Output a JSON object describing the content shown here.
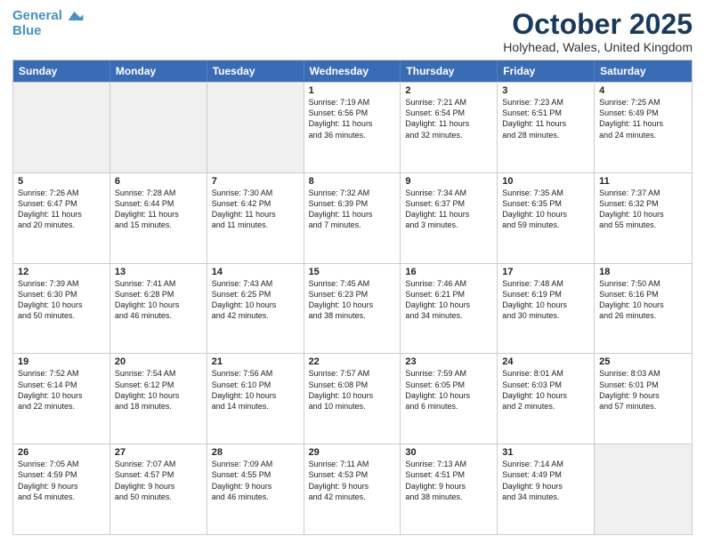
{
  "header": {
    "logo_line1": "General",
    "logo_line2": "Blue",
    "month": "October 2025",
    "location": "Holyhead, Wales, United Kingdom"
  },
  "days_of_week": [
    "Sunday",
    "Monday",
    "Tuesday",
    "Wednesday",
    "Thursday",
    "Friday",
    "Saturday"
  ],
  "rows": [
    [
      {
        "day": "",
        "text": "",
        "shaded": true
      },
      {
        "day": "",
        "text": "",
        "shaded": true
      },
      {
        "day": "",
        "text": "",
        "shaded": true
      },
      {
        "day": "1",
        "text": "Sunrise: 7:19 AM\nSunset: 6:56 PM\nDaylight: 11 hours\nand 36 minutes."
      },
      {
        "day": "2",
        "text": "Sunrise: 7:21 AM\nSunset: 6:54 PM\nDaylight: 11 hours\nand 32 minutes."
      },
      {
        "day": "3",
        "text": "Sunrise: 7:23 AM\nSunset: 6:51 PM\nDaylight: 11 hours\nand 28 minutes."
      },
      {
        "day": "4",
        "text": "Sunrise: 7:25 AM\nSunset: 6:49 PM\nDaylight: 11 hours\nand 24 minutes."
      }
    ],
    [
      {
        "day": "5",
        "text": "Sunrise: 7:26 AM\nSunset: 6:47 PM\nDaylight: 11 hours\nand 20 minutes."
      },
      {
        "day": "6",
        "text": "Sunrise: 7:28 AM\nSunset: 6:44 PM\nDaylight: 11 hours\nand 15 minutes."
      },
      {
        "day": "7",
        "text": "Sunrise: 7:30 AM\nSunset: 6:42 PM\nDaylight: 11 hours\nand 11 minutes."
      },
      {
        "day": "8",
        "text": "Sunrise: 7:32 AM\nSunset: 6:39 PM\nDaylight: 11 hours\nand 7 minutes."
      },
      {
        "day": "9",
        "text": "Sunrise: 7:34 AM\nSunset: 6:37 PM\nDaylight: 11 hours\nand 3 minutes."
      },
      {
        "day": "10",
        "text": "Sunrise: 7:35 AM\nSunset: 6:35 PM\nDaylight: 10 hours\nand 59 minutes."
      },
      {
        "day": "11",
        "text": "Sunrise: 7:37 AM\nSunset: 6:32 PM\nDaylight: 10 hours\nand 55 minutes."
      }
    ],
    [
      {
        "day": "12",
        "text": "Sunrise: 7:39 AM\nSunset: 6:30 PM\nDaylight: 10 hours\nand 50 minutes."
      },
      {
        "day": "13",
        "text": "Sunrise: 7:41 AM\nSunset: 6:28 PM\nDaylight: 10 hours\nand 46 minutes."
      },
      {
        "day": "14",
        "text": "Sunrise: 7:43 AM\nSunset: 6:25 PM\nDaylight: 10 hours\nand 42 minutes."
      },
      {
        "day": "15",
        "text": "Sunrise: 7:45 AM\nSunset: 6:23 PM\nDaylight: 10 hours\nand 38 minutes."
      },
      {
        "day": "16",
        "text": "Sunrise: 7:46 AM\nSunset: 6:21 PM\nDaylight: 10 hours\nand 34 minutes."
      },
      {
        "day": "17",
        "text": "Sunrise: 7:48 AM\nSunset: 6:19 PM\nDaylight: 10 hours\nand 30 minutes."
      },
      {
        "day": "18",
        "text": "Sunrise: 7:50 AM\nSunset: 6:16 PM\nDaylight: 10 hours\nand 26 minutes."
      }
    ],
    [
      {
        "day": "19",
        "text": "Sunrise: 7:52 AM\nSunset: 6:14 PM\nDaylight: 10 hours\nand 22 minutes."
      },
      {
        "day": "20",
        "text": "Sunrise: 7:54 AM\nSunset: 6:12 PM\nDaylight: 10 hours\nand 18 minutes."
      },
      {
        "day": "21",
        "text": "Sunrise: 7:56 AM\nSunset: 6:10 PM\nDaylight: 10 hours\nand 14 minutes."
      },
      {
        "day": "22",
        "text": "Sunrise: 7:57 AM\nSunset: 6:08 PM\nDaylight: 10 hours\nand 10 minutes."
      },
      {
        "day": "23",
        "text": "Sunrise: 7:59 AM\nSunset: 6:05 PM\nDaylight: 10 hours\nand 6 minutes."
      },
      {
        "day": "24",
        "text": "Sunrise: 8:01 AM\nSunset: 6:03 PM\nDaylight: 10 hours\nand 2 minutes."
      },
      {
        "day": "25",
        "text": "Sunrise: 8:03 AM\nSunset: 6:01 PM\nDaylight: 9 hours\nand 57 minutes."
      }
    ],
    [
      {
        "day": "26",
        "text": "Sunrise: 7:05 AM\nSunset: 4:59 PM\nDaylight: 9 hours\nand 54 minutes."
      },
      {
        "day": "27",
        "text": "Sunrise: 7:07 AM\nSunset: 4:57 PM\nDaylight: 9 hours\nand 50 minutes."
      },
      {
        "day": "28",
        "text": "Sunrise: 7:09 AM\nSunset: 4:55 PM\nDaylight: 9 hours\nand 46 minutes."
      },
      {
        "day": "29",
        "text": "Sunrise: 7:11 AM\nSunset: 4:53 PM\nDaylight: 9 hours\nand 42 minutes."
      },
      {
        "day": "30",
        "text": "Sunrise: 7:13 AM\nSunset: 4:51 PM\nDaylight: 9 hours\nand 38 minutes."
      },
      {
        "day": "31",
        "text": "Sunrise: 7:14 AM\nSunset: 4:49 PM\nDaylight: 9 hours\nand 34 minutes."
      },
      {
        "day": "",
        "text": "",
        "shaded": true
      }
    ]
  ]
}
